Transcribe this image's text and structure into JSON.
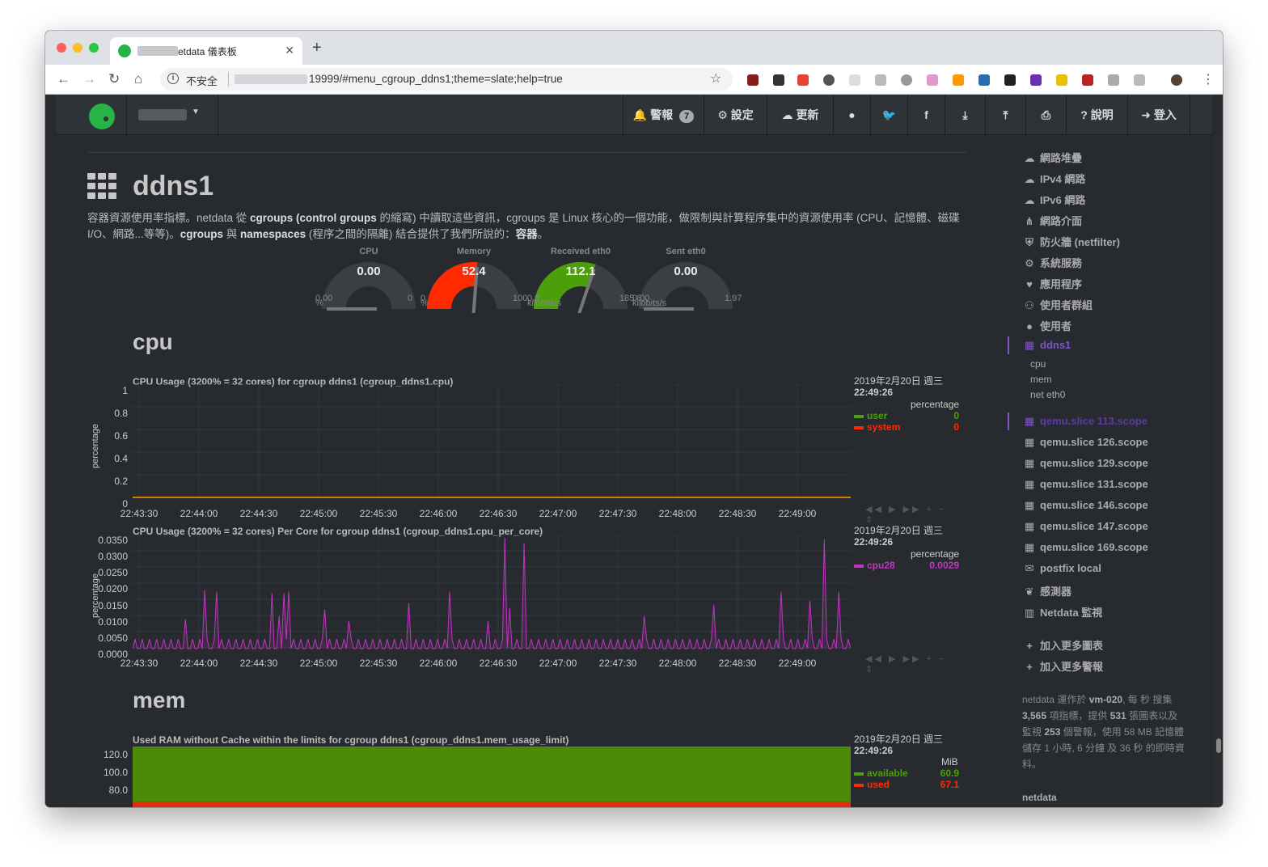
{
  "browser": {
    "tab_title": "etdata 儀表板",
    "insecure_label": "不安全",
    "url_suffix": "19999/#menu_cgroup_ddns1;theme=slate;help=true"
  },
  "topnav": {
    "alarms_label": "警報",
    "alarms_count": "7",
    "settings_label": "設定",
    "update_label": "更新",
    "help_label": "說明",
    "login_label": "登入"
  },
  "page": {
    "title": "ddns1",
    "desc_1": "容器資源使用率指標。netdata 從 ",
    "desc_b1": "cgroups (control groups",
    "desc_2": " 的縮寫) 中讀取這些資訊，cgroups 是 Linux 核心的一個功能，做限制與計算程序集中的資源使用率 (CPU、記憶體、磁碟 I/O、網路...等等)。",
    "desc_b2": "cgroups",
    "desc_3": " 與 ",
    "desc_b3": "namespaces",
    "desc_4": " (程序之間的隔離) 結合提供了我們所說的：",
    "desc_b4": "容器",
    "desc_5": "。"
  },
  "gauges": [
    {
      "title": "CPU",
      "value": "0.00",
      "min": "0.00",
      "max": "0",
      "unit": "%",
      "fraction": 0.0,
      "color": "#ff4136"
    },
    {
      "title": "Memory",
      "value": "52.4",
      "min": "0",
      "max": "100",
      "unit": "%",
      "fraction": 0.524,
      "color": "#ff2a00"
    },
    {
      "title": "Received eth0",
      "value": "112.1",
      "min": "0.0",
      "max": "185.8",
      "unit": "kilobits/s",
      "fraction": 0.603,
      "color": "#4c9e0a"
    },
    {
      "title": "Sent eth0",
      "value": "0.00",
      "min": "0.00",
      "max": "1.97",
      "unit": "kilobits/s",
      "fraction": 0.0,
      "color": "#4c9e0a"
    }
  ],
  "sections": {
    "cpu": "cpu",
    "mem": "mem"
  },
  "charts": {
    "cpu": {
      "title": "CPU Usage (3200% = 32 cores) for cgroup ddns1 (cgroup_ddns1.cpu)",
      "date": "2019年2月20日 週三",
      "time": "22:49:26",
      "unit": "percentage",
      "ylabel": "percentage",
      "legend": [
        {
          "name": "user",
          "value": "0",
          "color": "#4c9e0a"
        },
        {
          "name": "system",
          "value": "0",
          "color": "#ff2a00"
        }
      ]
    },
    "cpu_per_core": {
      "title": "CPU Usage (3200% = 32 cores) Per Core for cgroup ddns1 (cgroup_ddns1.cpu_per_core)",
      "date": "2019年2月20日 週三",
      "time": "22:49:26",
      "unit": "percentage",
      "ylabel": "percentage",
      "legend": [
        {
          "name": "cpu28",
          "value": "0.0029",
          "color": "#c334c3"
        }
      ]
    },
    "mem": {
      "title": "Used RAM without Cache within the limits for cgroup ddns1 (cgroup_ddns1.mem_usage_limit)",
      "date": "2019年2月20日 週三",
      "time": "22:49:26",
      "unit": "MiB",
      "legend": [
        {
          "name": "available",
          "value": "60.9",
          "color": "#4c9e0a"
        },
        {
          "name": "used",
          "value": "67.1",
          "color": "#ff2a00"
        }
      ]
    }
  },
  "chart_data": [
    {
      "type": "line",
      "title": "CPU Usage (3200% = 32 cores) for cgroup ddns1 (cgroup_ddns1.cpu)",
      "ylabel": "percentage",
      "yticks": [
        "1",
        "0.8",
        "0.6",
        "0.4",
        "0.2",
        "0"
      ],
      "ylim": [
        0,
        1
      ],
      "xticks": [
        "22:43:30",
        "22:44:00",
        "22:44:30",
        "22:45:00",
        "22:45:30",
        "22:46:00",
        "22:46:30",
        "22:47:00",
        "22:47:30",
        "22:48:00",
        "22:48:30",
        "22:49:00"
      ],
      "series": [
        {
          "name": "user",
          "values": [
            0,
            0,
            0,
            0,
            0,
            0,
            0,
            0,
            0,
            0,
            0,
            0
          ]
        },
        {
          "name": "system",
          "values": [
            0,
            0,
            0,
            0,
            0,
            0,
            0,
            0,
            0,
            0,
            0,
            0
          ]
        }
      ]
    },
    {
      "type": "area",
      "title": "CPU Usage (3200% = 32 cores) Per Core for cgroup ddns1 (cgroup_ddns1.cpu_per_core)",
      "ylabel": "percentage",
      "yticks": [
        "0.0350",
        "0.0300",
        "0.0250",
        "0.0200",
        "0.0150",
        "0.0100",
        "0.0050",
        "0.0000"
      ],
      "ylim": [
        0,
        0.035
      ],
      "xticks": [
        "22:43:30",
        "22:44:00",
        "22:44:30",
        "22:45:00",
        "22:45:30",
        "22:46:00",
        "22:46:30",
        "22:47:00",
        "22:47:30",
        "22:48:00",
        "22:48:30",
        "22:49:00"
      ],
      "series": [
        {
          "name": "cpu28",
          "spikes": [
            [
              22,
              0.009
            ],
            [
              30,
              0.018
            ],
            [
              35,
              0.0175
            ],
            [
              58,
              0.017
            ],
            [
              61,
              0.01
            ],
            [
              63,
              0.017
            ],
            [
              65,
              0.0175
            ],
            [
              80,
              0.012
            ],
            [
              90,
              0.0085
            ],
            [
              115,
              0.014
            ],
            [
              132,
              0.0175
            ],
            [
              148,
              0.0084
            ],
            [
              155,
              0.034
            ],
            [
              157,
              0.0125
            ],
            [
              163,
              0.0323
            ],
            [
              213,
              0.01
            ],
            [
              242,
              0.0135
            ],
            [
              270,
              0.0175
            ],
            [
              282,
              0.0147
            ],
            [
              288,
              0.0335
            ],
            [
              294,
              0.0175
            ]
          ],
          "baseline_peak": 0.0029
        }
      ]
    },
    {
      "type": "area",
      "title": "Used RAM without Cache within the limits for cgroup ddns1 (cgroup_ddns1.mem_usage_limit)",
      "yticks": [
        "120.0",
        "100.0",
        "80.0"
      ],
      "series": [
        {
          "name": "available",
          "value": 60.9
        },
        {
          "name": "used",
          "value": 67.1
        }
      ]
    }
  ],
  "sidebar": {
    "items": [
      {
        "label": "網路堆疊",
        "icon": "cloud-icon"
      },
      {
        "label": "IPv4 網路",
        "icon": "cloud-icon"
      },
      {
        "label": "IPv6 網路",
        "icon": "cloud-icon"
      },
      {
        "label": "網路介面",
        "icon": "network-icon"
      },
      {
        "label": "防火牆 (netfilter)",
        "icon": "shield-icon"
      },
      {
        "label": "系統服務",
        "icon": "gears-icon"
      },
      {
        "label": "應用程序",
        "icon": "heartbeat-icon"
      },
      {
        "label": "使用者群組",
        "icon": "users-icon"
      },
      {
        "label": "使用者",
        "icon": "user-icon"
      },
      {
        "label": "ddns1",
        "icon": "grid-icon"
      }
    ],
    "subitems": [
      "cpu",
      "mem",
      "net eth0"
    ],
    "items2": [
      {
        "label": "qemu.slice 113.scope",
        "icon": "grid-icon"
      },
      {
        "label": "qemu.slice 126.scope",
        "icon": "grid-icon"
      },
      {
        "label": "qemu.slice 129.scope",
        "icon": "grid-icon"
      },
      {
        "label": "qemu.slice 131.scope",
        "icon": "grid-icon"
      },
      {
        "label": "qemu.slice 146.scope",
        "icon": "grid-icon"
      },
      {
        "label": "qemu.slice 147.scope",
        "icon": "grid-icon"
      },
      {
        "label": "qemu.slice 169.scope",
        "icon": "grid-icon"
      },
      {
        "label": "postfix local",
        "icon": "envelope-icon"
      },
      {
        "label": "感測器",
        "icon": "leaf-icon"
      },
      {
        "label": "Netdata 監視",
        "icon": "bar-chart-icon"
      }
    ],
    "add_charts": "加入更多圖表",
    "add_alarms": "加入更多警報",
    "foot_1": "netdata 運作於 ",
    "foot_host": "vm-020",
    "foot_2": ", 每 秒 搜集 ",
    "foot_metrics": "3,565",
    "foot_3": " 項指標，提供 ",
    "foot_charts": "531",
    "foot_4": " 張圖表以及 監視 ",
    "foot_alarms": "253",
    "foot_5": " 個警報，使用 58 MB 記憶體 儲存 1 小時, 6 分鐘 及 36 秒 的即時資料。",
    "foot_brand": "netdata"
  },
  "colors": {
    "background": "#272b30",
    "accent_purple": "#7e57c2",
    "user_green": "#4c9e0a",
    "system_red": "#ff2a00",
    "cpu28_magenta": "#c334c3"
  }
}
